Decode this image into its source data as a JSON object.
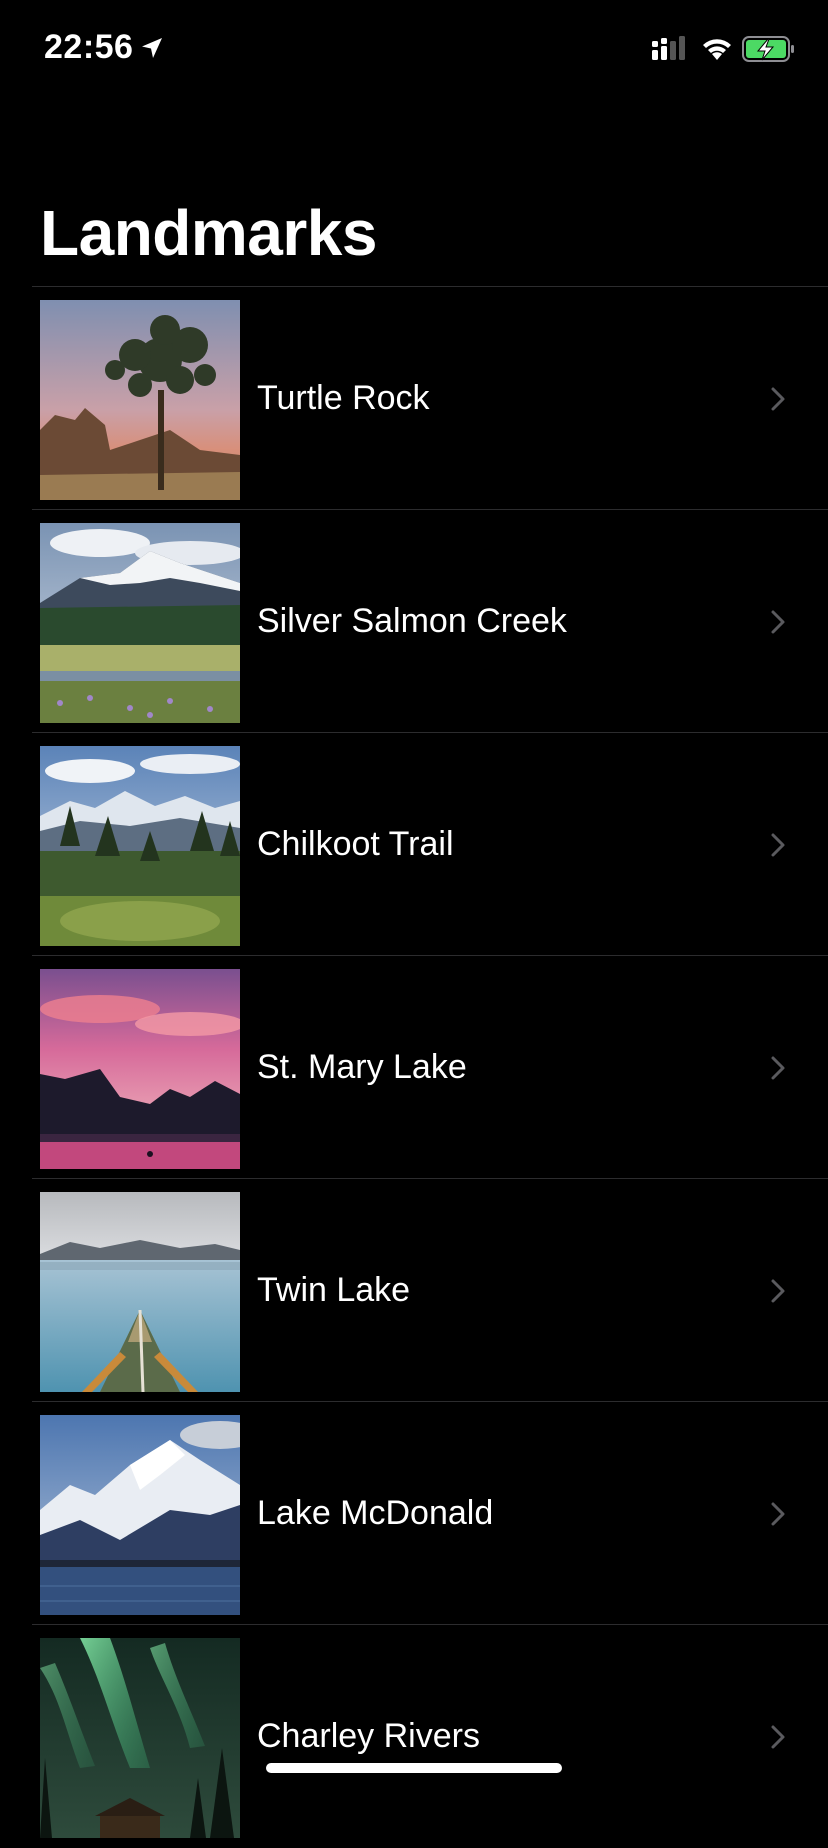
{
  "status_bar": {
    "time": "22:56",
    "icons": [
      "location-arrow-icon",
      "cellular-signal-icon",
      "wifi-icon",
      "battery-charging-icon"
    ],
    "battery_color": "#4cd964"
  },
  "nav": {
    "title": "Landmarks"
  },
  "landmarks": [
    {
      "name": "Turtle Rock",
      "image": "joshua-tree-photo"
    },
    {
      "name": "Silver Salmon Creek",
      "image": "snowy-mountain-meadow-photo"
    },
    {
      "name": "Chilkoot Trail",
      "image": "forest-mountains-photo"
    },
    {
      "name": "St. Mary Lake",
      "image": "pink-sunset-lake-photo"
    },
    {
      "name": "Twin Lake",
      "image": "canoe-lake-photo"
    },
    {
      "name": "Lake McDonald",
      "image": "snow-peak-lake-photo"
    },
    {
      "name": "Charley Rivers",
      "image": "aurora-photo"
    }
  ],
  "colors": {
    "background": "#000000",
    "separator": "#2c2c2e",
    "chevron": "#5a5a5e"
  }
}
